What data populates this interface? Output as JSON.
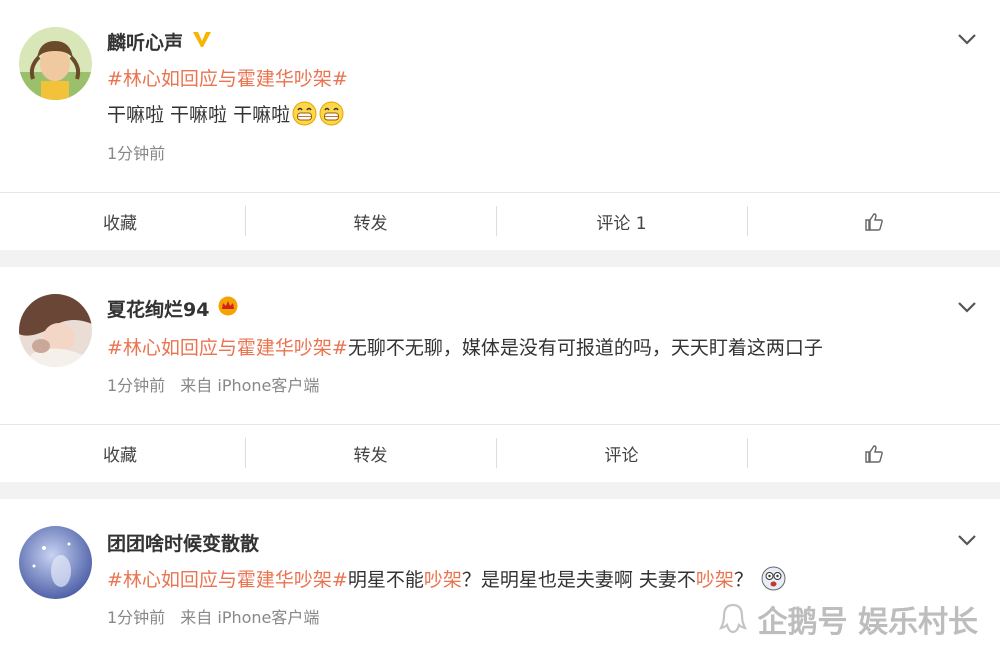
{
  "posts": [
    {
      "username": "麟听心声",
      "badge": "v-badge-icon",
      "hashtag": "#林心如回应与霍建华吵架#",
      "text_pre": "干嘛啦 干嘛啦 干嘛啦",
      "time": "1分钟前",
      "source": "",
      "actions": {
        "fav": "收藏",
        "repost": "转发",
        "comment": "评论 1"
      }
    },
    {
      "username": "夏花绚烂94",
      "badge": "crown-badge-icon",
      "hashtag": "#林心如回应与霍建华吵架#",
      "text_pre": "无聊不无聊，媒体是没有可报道的吗，天天盯着这两口子",
      "time": "1分钟前",
      "source": "来自 iPhone客户端",
      "actions": {
        "fav": "收藏",
        "repost": "转发",
        "comment": "评论"
      }
    },
    {
      "username": "团团啥时候变散散",
      "badge": "",
      "hashtag": "#林心如回应与霍建华吵架#",
      "text_a": "明星不能",
      "text_b": "吵架",
      "text_c": "？是明星也是夫妻啊 夫妻不",
      "text_d": "吵架",
      "text_e": "？",
      "time": "1分钟前",
      "source": "来自 iPhone客户端"
    }
  ],
  "watermark": "企鹅号 娱乐村长",
  "colors": {
    "hashtag": "#eb7350",
    "link": "#5b8bd6",
    "meta": "#888888",
    "separator": "#f2f2f2"
  }
}
